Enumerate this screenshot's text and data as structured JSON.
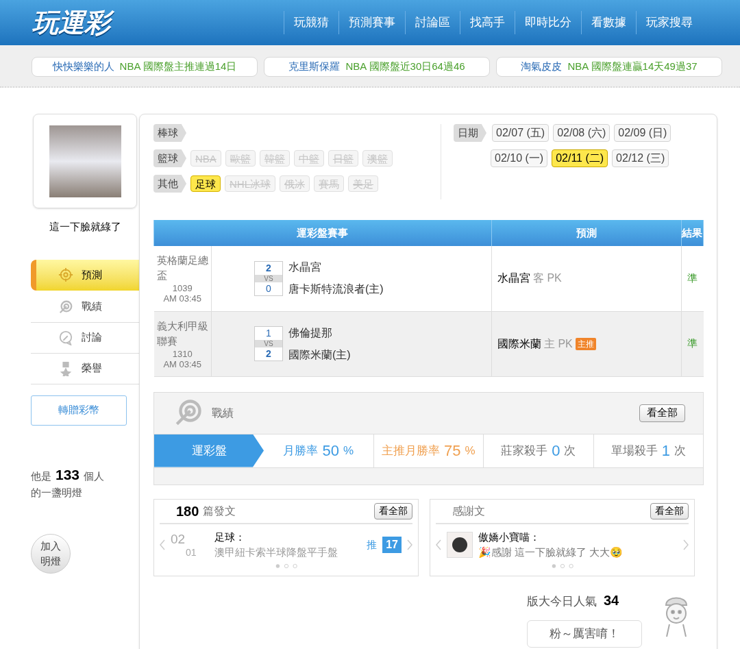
{
  "logo": "玩運彩",
  "nav": [
    "玩競猜",
    "預測賽事",
    "討論區",
    "找高手",
    "即時比分",
    "看數據",
    "玩家搜尋"
  ],
  "ticker": [
    {
      "user": "快快樂樂的人",
      "text": "NBA  國際盤主推連過14日"
    },
    {
      "user": "克里斯保羅",
      "text": "NBA  國際盤近30日64過46"
    },
    {
      "user": "淘氣皮皮",
      "text": "NBA  國際盤連贏14天49過37"
    }
  ],
  "profile": {
    "name": "這一下臉就綠了"
  },
  "side_menu": [
    {
      "label": "預測",
      "selected": true
    },
    {
      "label": "戰績",
      "selected": false
    },
    {
      "label": "討論",
      "selected": false
    },
    {
      "label": "榮譽",
      "selected": false
    }
  ],
  "gift_button": "轉贈彩幣",
  "lamp": {
    "prefix": "他是",
    "count": "133",
    "suffix": "個人",
    "line2": "的一盞明燈",
    "button": "加入明燈"
  },
  "filters": [
    {
      "label": "棒球"
    },
    {
      "label": "籃球",
      "items": [
        {
          "label": "NBA",
          "selected": false,
          "disabled": true
        },
        {
          "label": "歐籃",
          "selected": false,
          "disabled": true
        },
        {
          "label": "韓籃",
          "selected": false,
          "disabled": true
        },
        {
          "label": "中籃",
          "selected": false,
          "disabled": true
        },
        {
          "label": "日籃",
          "selected": false,
          "disabled": true
        },
        {
          "label": "澳籃",
          "selected": false,
          "disabled": true
        }
      ]
    },
    {
      "label": "其他",
      "items": [
        {
          "label": "足球",
          "selected": true,
          "disabled": false
        },
        {
          "label": "NHL冰球",
          "selected": false,
          "disabled": true
        },
        {
          "label": "俄冰",
          "selected": false,
          "disabled": true
        },
        {
          "label": "賽馬",
          "selected": false,
          "disabled": true
        },
        {
          "label": "美足",
          "selected": false,
          "disabled": true
        }
      ]
    }
  ],
  "dates": {
    "label": "日期",
    "rows": [
      [
        {
          "label": "02/07 (五)",
          "selected": false
        },
        {
          "label": "02/08 (六)",
          "selected": false
        },
        {
          "label": "02/09 (日)",
          "selected": false
        }
      ],
      [
        {
          "label": "02/10 (一)",
          "selected": false
        },
        {
          "label": "02/11 (二)",
          "selected": true
        },
        {
          "label": "02/12 (三)",
          "selected": false
        }
      ]
    ]
  },
  "table": {
    "columns": [
      "運彩盤賽事",
      "預測",
      "結果"
    ],
    "rows": [
      {
        "league": "英格蘭足總盃",
        "code": "1039",
        "time": "AM 03:45",
        "score1": "2",
        "vs": "VS",
        "score2": "0",
        "team1": "水晶宮",
        "team2": "唐卡斯特流浪者(主)",
        "pick_team": "水晶宮",
        "pick_side": "客 PK",
        "badge": null,
        "result": "準"
      },
      {
        "league": "義大利甲級聯賽",
        "code": "1310",
        "time": "AM 03:45",
        "score1": "1",
        "vs": "VS",
        "score2": "2",
        "team1": "佛倫提那",
        "team2": "國際米蘭(主)",
        "pick_team": "國際米蘭",
        "pick_side": "主 PK",
        "badge": "主推",
        "result": "準"
      }
    ]
  },
  "record": {
    "title": "戰績",
    "view_all": "看全部",
    "tab": "運彩盤",
    "stats": [
      {
        "label": "月勝率",
        "value": "50",
        "unit": "%",
        "color": "#3d9be3"
      },
      {
        "label": "主推月勝率",
        "value": "75",
        "unit": "%",
        "color": "#f0a050"
      },
      {
        "label": "莊家殺手",
        "value": "0",
        "unit": "次",
        "color": "#3d9be3"
      },
      {
        "label": "單場殺手",
        "value": "1",
        "unit": "次",
        "color": "#3d9be3"
      }
    ]
  },
  "posts": {
    "count": "180",
    "label": "篇發文",
    "view_all": "看全部",
    "month": "02",
    "day": "01",
    "category": "足球：",
    "title": "澳甲紐卡索半球降盤平手盤",
    "push_label": "推",
    "push_count": "17"
  },
  "thanks": {
    "title": "感謝文",
    "view_all": "看全部",
    "user": "傲嬌小寶喵：",
    "text": "🎉感謝 這一下臉就綠了 大大🥹"
  },
  "popularity": {
    "label": "版大今日人氣",
    "count": "34",
    "bubble": "粉～厲害唷！"
  }
}
